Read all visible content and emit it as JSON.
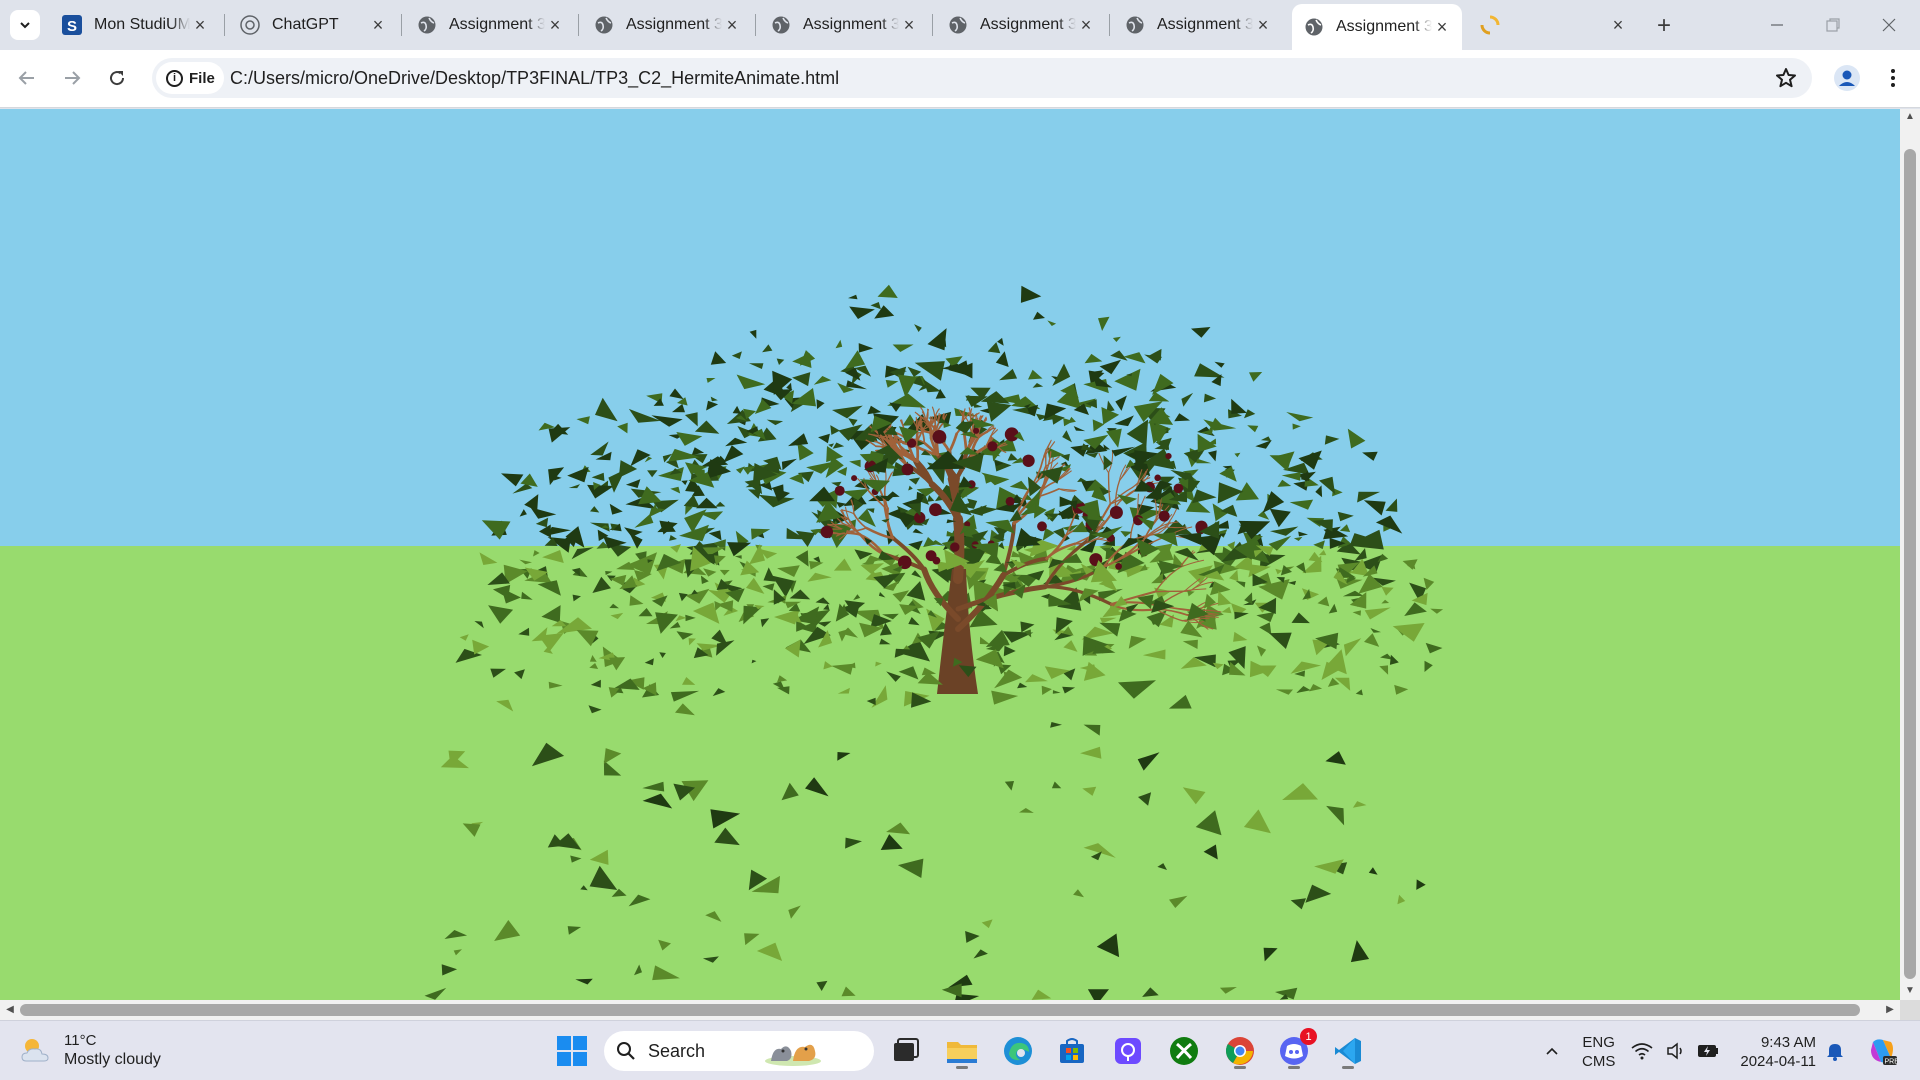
{
  "browser": {
    "tabs": [
      {
        "title": "Mon StudiUM",
        "icon": "studium-s-icon",
        "active": false
      },
      {
        "title": "ChatGPT",
        "icon": "chatgpt-icon",
        "active": false
      },
      {
        "title": "Assignment 3",
        "icon": "globe-icon",
        "active": false
      },
      {
        "title": "Assignment 3",
        "icon": "globe-icon",
        "active": false
      },
      {
        "title": "Assignment 3",
        "icon": "globe-icon",
        "active": false
      },
      {
        "title": "Assignment 3",
        "icon": "globe-icon",
        "active": false
      },
      {
        "title": "Assignment 3",
        "icon": "globe-icon",
        "active": false
      },
      {
        "title": "Assignment 3",
        "icon": "globe-icon",
        "active": true
      },
      {
        "title": "",
        "icon": "loading-icon",
        "active": false
      }
    ],
    "address": {
      "scheme_chip": "File",
      "url": "C:/Users/micro/OneDrive/Desktop/TP3FINAL/TP3_C2_HermiteAnimate.html"
    }
  },
  "scene": {
    "sky_color": "#87CEEB",
    "ground_color": "#98DB6E",
    "trunk_color": "#6B4226",
    "leaf_colors": [
      "#1f3a12",
      "#2c4f18",
      "#3f6b1f",
      "#5b8a2a",
      "#78a838"
    ],
    "fruit_color": "#5a0f1a"
  },
  "taskbar": {
    "weather": {
      "temp": "11°C",
      "desc": "Mostly cloudy"
    },
    "search_label": "Search",
    "apps": [
      "file-explorer",
      "edge",
      "store",
      "proton-pass",
      "xbox",
      "chrome",
      "discord",
      "vscode"
    ],
    "discord_badge": "1",
    "tray": {
      "lang": "ENG",
      "ime": "CMS"
    },
    "clock": {
      "time": "9:43 AM",
      "date": "2024-04-11"
    }
  }
}
